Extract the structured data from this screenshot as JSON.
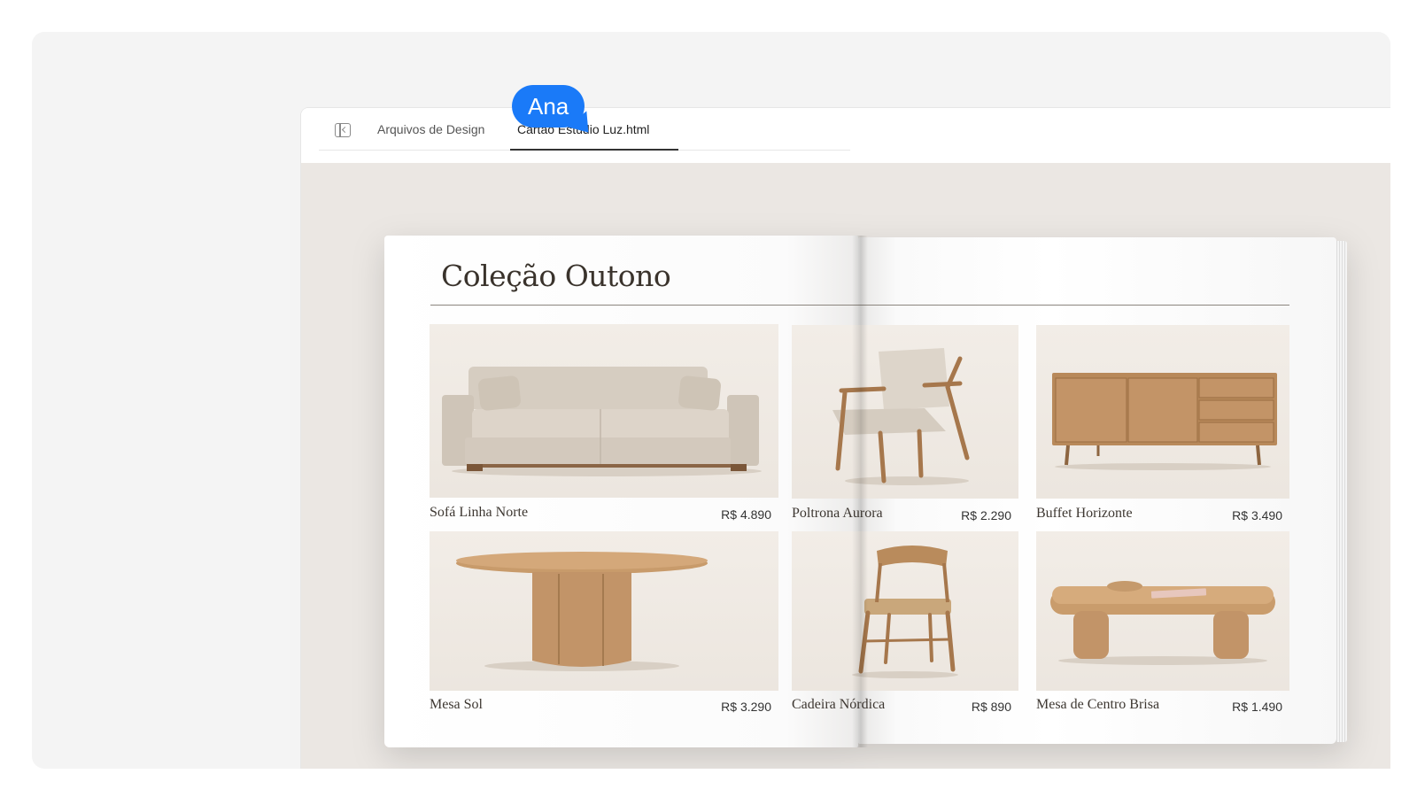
{
  "cursor": {
    "user": "Ana",
    "color": "#1a7af8"
  },
  "tabs": {
    "inactive_label": "Arquivos de Design",
    "active_label": "Cartão Estúdio Luz.html"
  },
  "catalog": {
    "title": "Coleção Outono",
    "products": [
      {
        "name": "Sofá Linha Norte",
        "price": "R$ 4.890",
        "icon": "sofa"
      },
      {
        "name": "Poltrona Aurora",
        "price": "R$ 2.290",
        "icon": "armchair"
      },
      {
        "name": "Buffet Horizonte",
        "price": "R$ 3.490",
        "icon": "sideboard"
      },
      {
        "name": "Mesa Sol",
        "price": "R$ 3.290",
        "icon": "round-table"
      },
      {
        "name": "Cadeira Nórdica",
        "price": "R$ 890",
        "icon": "chair"
      },
      {
        "name": "Mesa de Centro Brisa",
        "price": "R$ 1.490",
        "icon": "coffee-table"
      }
    ]
  },
  "colors": {
    "wood": "#b88a5a",
    "fabric": "#d9d0c5",
    "accent": "#1a7af8"
  }
}
